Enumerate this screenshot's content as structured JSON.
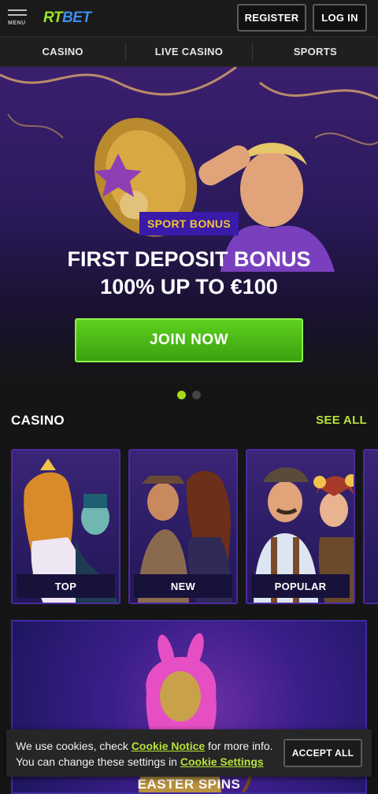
{
  "header": {
    "menu_label": "MENU",
    "logo_rt": "RT",
    "logo_bet": "BET",
    "register_label": "REGISTER",
    "login_label": "LOG IN"
  },
  "nav": {
    "items": [
      {
        "label": "CASINO"
      },
      {
        "label": "LIVE CASINO"
      },
      {
        "label": "SPORTS"
      }
    ]
  },
  "hero": {
    "badge": "SPORT BONUS",
    "title_line1": "FIRST DEPOSIT BONUS",
    "title_line2": "100% UP TO €100",
    "cta_label": "JOIN NOW",
    "slides_total": 2,
    "active_slide": 1
  },
  "casino": {
    "title": "CASINO",
    "see_all": "SEE ALL",
    "cards": [
      {
        "label": "TOP"
      },
      {
        "label": "NEW"
      },
      {
        "label": "POPULAR"
      }
    ]
  },
  "promo": {
    "title": "EASTER SPINS"
  },
  "cookie": {
    "text_1": "We use cookies, check ",
    "link_notice": "Cookie Notice",
    "text_2": " for more info. You can change these settings in ",
    "link_settings": "Cookie Settings",
    "accept_label": "ACCEPT ALL"
  },
  "colors": {
    "accent_green": "#b7e23a",
    "cta_green": "#3aa10f",
    "badge_bg": "#3a1aa8",
    "badge_text": "#f2c62f",
    "logo_rt": "#9be82a",
    "logo_bet": "#3c8ef0"
  }
}
